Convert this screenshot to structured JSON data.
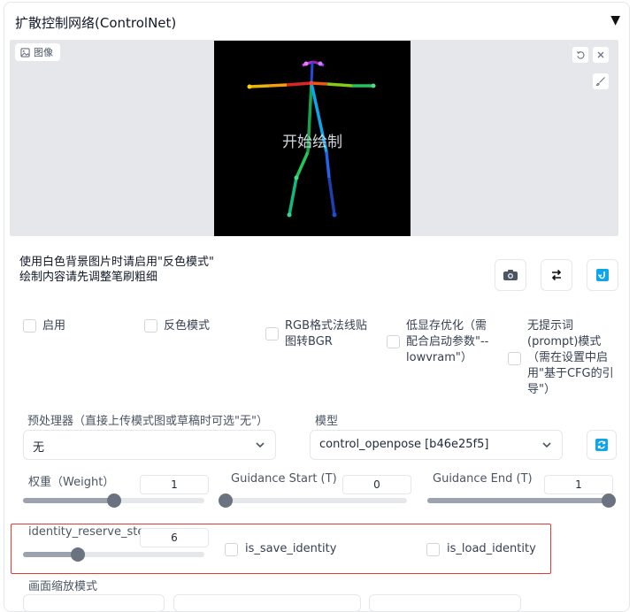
{
  "panel": {
    "title": "扩散控制网络(ControlNet)",
    "collapse_symbol": "▼"
  },
  "image_area": {
    "label": "图像",
    "canvas_text": "开始绘制"
  },
  "hints": {
    "line1": "使用白色背景图片时请启用\"反色模式\"",
    "line2": "绘制内容请先调整笔刷粗细"
  },
  "checkboxes": {
    "enable": "启用",
    "invert": "反色模式",
    "rgb_bgr_line1": "RGB格式法线贴",
    "rgb_bgr_line2": "图转BGR",
    "lowvram_line1": "低显存优化（需",
    "lowvram_line2": "配合启动参数\"--",
    "lowvram_line3": "lowvram\"）",
    "guess_line1": "无提示词",
    "guess_line2": "(prompt)模式",
    "guess_line3": "（需在设置中启",
    "guess_line4": "用\"基于CFG的引",
    "guess_line5": "导\"）"
  },
  "preprocessor": {
    "label": "预处理器（直接上传模式图或草稿时可选\"无\"）",
    "value": "无"
  },
  "model": {
    "label": "模型",
    "value": "control_openpose [b46e25f5]"
  },
  "weight": {
    "label": "权重（Weight）",
    "value": "1",
    "fraction": 0.5
  },
  "guidance_start": {
    "label": "Guidance Start (T)",
    "value": "0",
    "fraction": 0.0
  },
  "guidance_end": {
    "label": "Guidance End (T)",
    "value": "1",
    "fraction": 1.0
  },
  "identity_reserve_step": {
    "label": "identity_reserve_step",
    "value": "6",
    "fraction": 0.3
  },
  "is_save_identity": {
    "label": "is_save_identity"
  },
  "is_load_identity": {
    "label": "is_load_identity"
  },
  "resize_mode": {
    "label": "画面缩放模式"
  },
  "colors": {
    "accent": "#0ea5e9",
    "highlight_box": "#e53935"
  }
}
